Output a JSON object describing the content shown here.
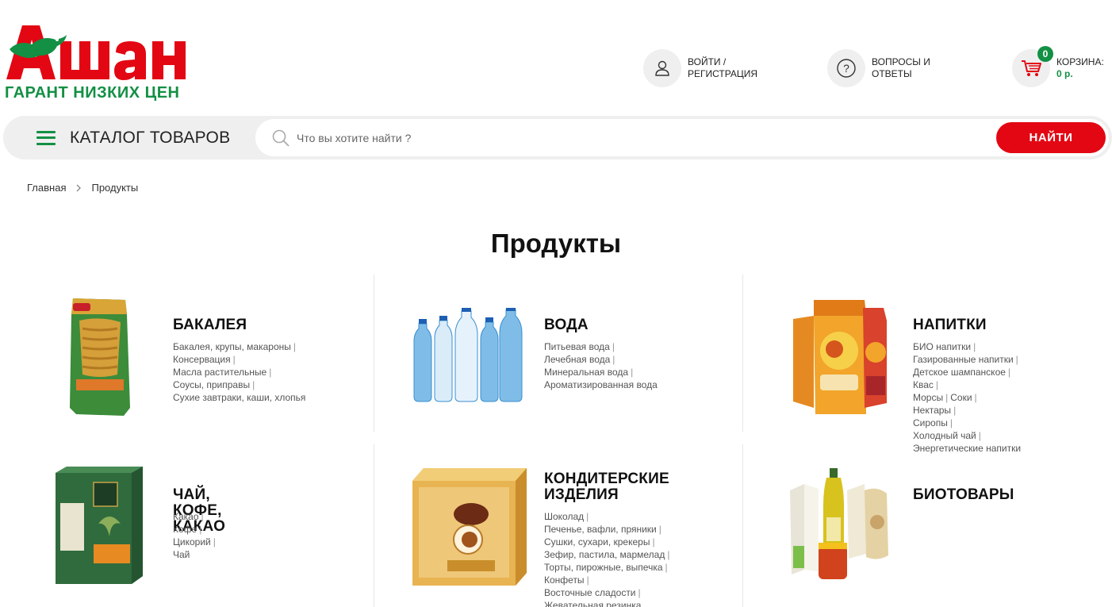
{
  "brand": {
    "logo_text": "Ашан",
    "slogan": "ГАРАНТ НИЗКИХ ЦЕН",
    "colors": {
      "red": "#e30613",
      "green": "#139044"
    }
  },
  "header": {
    "login": {
      "icon": "user-icon",
      "line1": "ВОЙТИ /",
      "line2": "РЕГИСТРАЦИЯ"
    },
    "faq": {
      "icon": "question-icon",
      "line1": "ВОПРОСЫ И",
      "line2": "ОТВЕТЫ"
    },
    "cart": {
      "icon": "cart-icon",
      "count": "0",
      "label": "КОРЗИНА:",
      "sum": "0 р."
    }
  },
  "search": {
    "catalog_label": "КАТАЛОГ ТОВАРОВ",
    "placeholder": "Что вы хотите найти ?",
    "button": "НАЙТИ"
  },
  "breadcrumb": {
    "home": "Главная",
    "current": "Продукты"
  },
  "page_title": "Продукты",
  "categories": [
    {
      "title": "БАКАЛЕЯ",
      "image": "pasta-package",
      "lines": [
        [
          "Бакалея, крупы, макароны"
        ],
        [
          "Консервация"
        ],
        [
          "Масла растительные"
        ],
        [
          "Соусы, приправы"
        ],
        [
          "Сухие завтраки, каши, хлопья"
        ]
      ]
    },
    {
      "title": "ВОДА",
      "image": "water-bottles",
      "lines": [
        [
          "Питьевая вода",
          "Лечебная вода"
        ],
        [
          "Минеральная вода"
        ],
        [
          "Ароматизированная вода"
        ]
      ]
    },
    {
      "title": "НАПИТКИ",
      "image": "juice-cartons",
      "lines": [
        [
          "БИО напитки"
        ],
        [
          "Газированные напитки"
        ],
        [
          "Детское шампанское",
          "Квас"
        ],
        [
          "Морсы",
          "Соки",
          "Нектары"
        ],
        [
          "Сиропы",
          "Холодный чай"
        ],
        [
          "Энергетические напитки"
        ]
      ]
    },
    {
      "title": "ЧАЙ, КОФЕ, КАКАО",
      "image": "tea-box",
      "lines": [
        [
          "Какао",
          "Кофе",
          "Цикорий",
          "Чай"
        ]
      ]
    },
    {
      "title_line1": "КОНДИТЕРСКИЕ",
      "title_line2": "ИЗДЕЛИЯ",
      "image": "candy-box",
      "lines": [
        [
          "Шоколад"
        ],
        [
          "Печенье, вафли, пряники"
        ],
        [
          "Сушки, сухари, крекеры"
        ],
        [
          "Зефир, пастила, мармелад"
        ],
        [
          "Торты, пирожные, выпечка"
        ],
        [
          "Конфеты",
          "Восточные сладости"
        ],
        [
          "Жевательная резинка"
        ]
      ]
    },
    {
      "title": "БИОТОВАРЫ",
      "image": "bio-products",
      "lines": []
    }
  ]
}
